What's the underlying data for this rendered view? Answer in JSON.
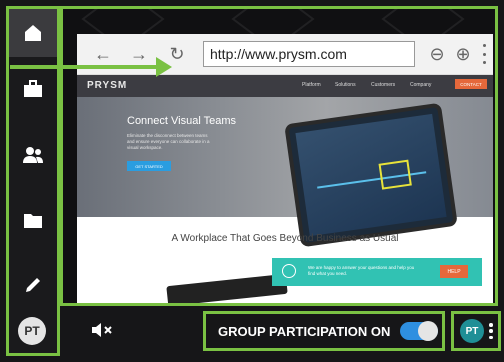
{
  "browser": {
    "url": "http://www.prysm.com"
  },
  "site": {
    "logo": "PRYSM",
    "nav": [
      "Platform",
      "Solutions",
      "Customers",
      "Company"
    ],
    "contact_label": "CONTACT",
    "hero_title": "Connect Visual Teams",
    "hero_text": "Eliminate the disconnect between teams and ensure everyone can collaborate in a visual workspace.",
    "hero_button": "GET STARTED",
    "tagline": "A Workplace That Goes Beyond Business as Usual",
    "cta_text": "We are happy to answer your questions and help you find what you need.",
    "help_label": "HELP"
  },
  "sidebar": {
    "items": [
      {
        "icon": "home-icon",
        "active": true
      },
      {
        "icon": "briefcase-icon",
        "active": false
      },
      {
        "icon": "people-icon",
        "active": false
      },
      {
        "icon": "folder-icon",
        "active": false
      },
      {
        "icon": "pencil-icon",
        "active": false
      }
    ],
    "avatar_initials": "PT"
  },
  "bottombar": {
    "mute_icon": "mute-icon",
    "group_participation_label": "GROUP PARTICIPATION ON",
    "group_participation_on": true,
    "user_initials": "PT"
  },
  "colors": {
    "highlight": "#7ac143",
    "toggle": "#2e8fe0",
    "user_badge": "#1f8f96",
    "accent_orange": "#e5683b"
  }
}
